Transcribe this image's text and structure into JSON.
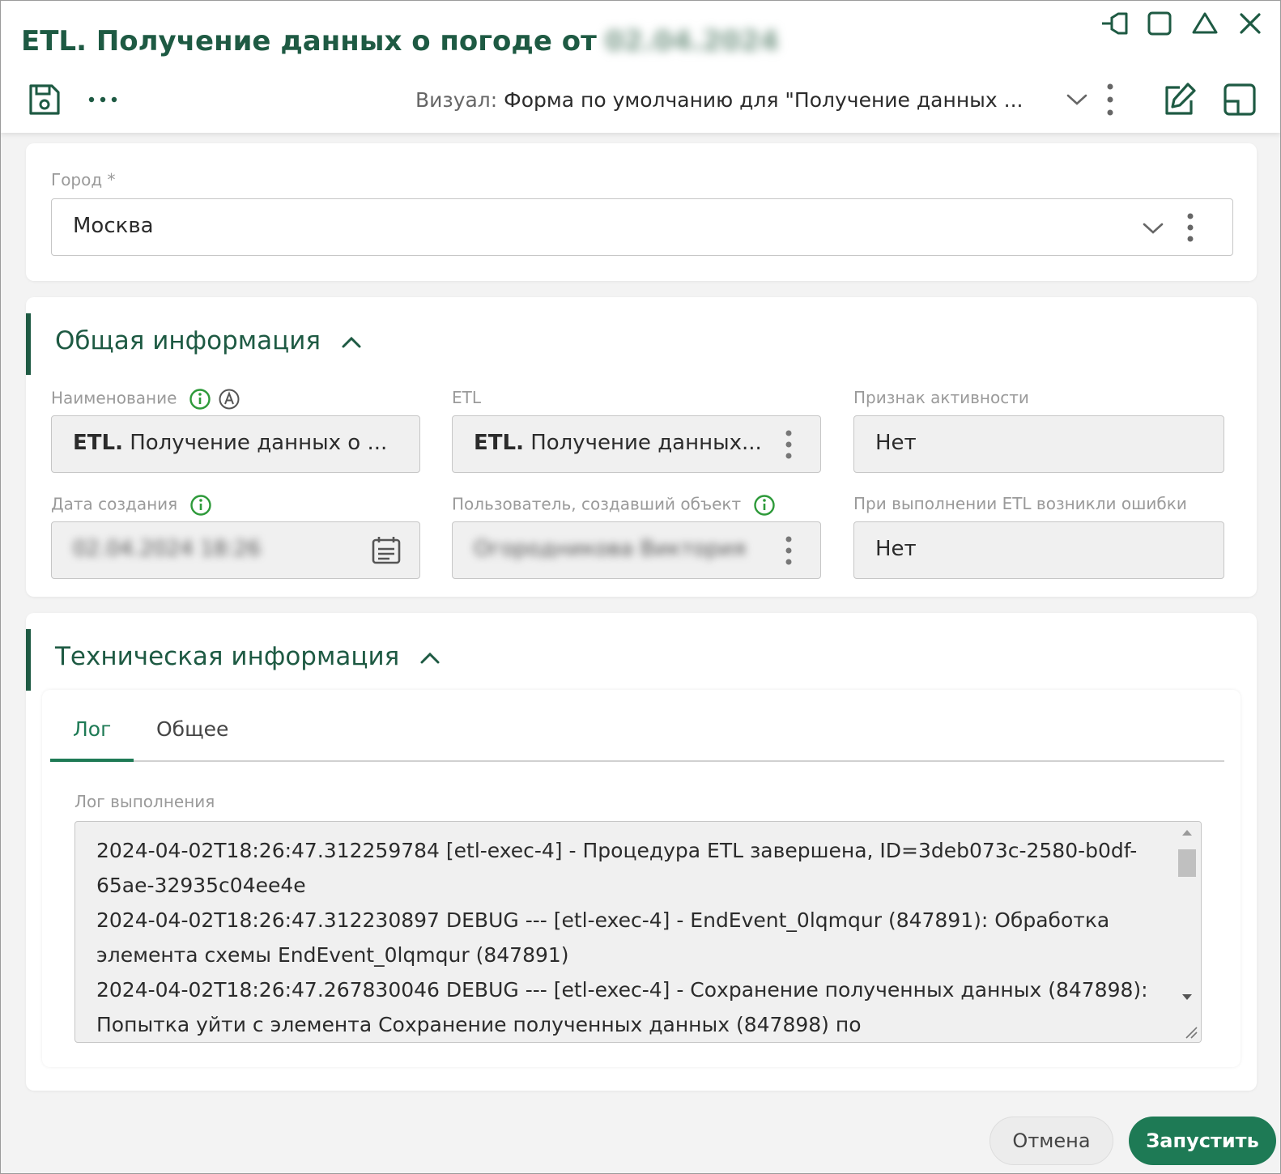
{
  "window": {
    "title": "ETL. Получение данных о погоде от",
    "title_date_blurred": "02.04.2024",
    "controls": [
      "pin-icon",
      "maximize-icon",
      "collapse-icon",
      "close-icon"
    ]
  },
  "toolbar": {
    "save_icon": "save-icon",
    "more_icon": "more-horizontal-icon",
    "visual_label": "Визуал:",
    "visual_value": "Форма по умолчанию для \"Получение данных ...",
    "edit_icon": "edit-icon",
    "layout_icon": "layout-icon"
  },
  "city": {
    "label": "Город *",
    "value": "Москва"
  },
  "general": {
    "title": "Общая информация",
    "fields": {
      "name": {
        "label": "Наименование",
        "value_bold": "ETL.",
        "value": " Получение данных о ..."
      },
      "etl": {
        "label": "ETL",
        "value_bold": "ETL.",
        "value": " Получение данных..."
      },
      "active": {
        "label": "Признак активности",
        "value": "Нет"
      },
      "created": {
        "label": "Дата создания",
        "value": "02.04.2024 18:26"
      },
      "creator": {
        "label": "Пользователь, создавший объект",
        "value": "Огородникова Виктория"
      },
      "errors": {
        "label": "При выполнении ETL возникли ошибки",
        "value": "Нет"
      }
    }
  },
  "tech": {
    "title": "Техническая информация",
    "tabs": [
      "Лог",
      "Общее"
    ],
    "active_tab": "Лог",
    "log_label": "Лог выполнения",
    "log_lines": [
      "2024-04-02T18:26:47.312259784 [etl-exec-4] - Процедура ETL завершена, ID=3deb073c-2580-b0df-65ae-32935c04ee4e",
      "2024-04-02T18:26:47.312230897 DEBUG --- [etl-exec-4] - EndEvent_0lqmqur (847891): Обработка элемента схемы EndEvent_0lqmqur (847891)",
      "2024-04-02T18:26:47.267830046 DEBUG --- [etl-exec-4] - Сохранение полученных данных (847898): Попытка уйти с элемента Сохранение полученных данных (847898) по"
    ]
  },
  "footer": {
    "cancel": "Отмена",
    "run": "Запустить"
  },
  "colors": {
    "brand": "#1e5a43",
    "accent": "#1e7a55",
    "info": "#2e9a3a"
  }
}
